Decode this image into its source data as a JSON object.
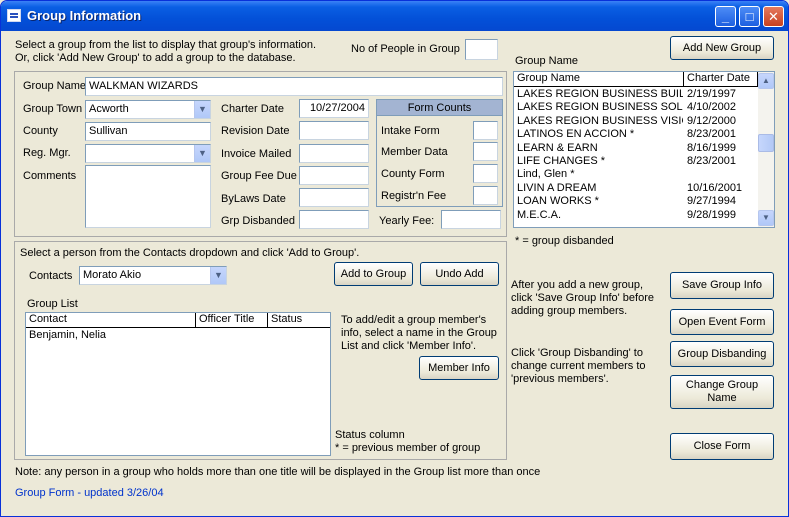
{
  "window": {
    "title": "Group Information",
    "controls": {
      "minimize": "_",
      "maximize": "□",
      "close": "✕"
    }
  },
  "intro": {
    "line1": "Select a group from the list to display that group's information.",
    "line2": "Or, click 'Add New Group'  to add a group to the database."
  },
  "no_people": {
    "label": "No of People in Group",
    "value": ""
  },
  "add_new_group_label": "Add New Group",
  "group_name": {
    "label": "Group Name",
    "value": "WALKMAN WIZARDS"
  },
  "group_town": {
    "label": "Group Town",
    "value": "Acworth"
  },
  "county": {
    "label": "County",
    "value": "Sullivan"
  },
  "reg_mgr": {
    "label": "Reg. Mgr.",
    "value": ""
  },
  "comments": {
    "label": "Comments",
    "value": ""
  },
  "charter_date": {
    "label": "Charter Date",
    "value": "10/27/2004"
  },
  "revision_date": {
    "label": "Revision Date",
    "value": ""
  },
  "invoice_mailed": {
    "label": "Invoice Mailed",
    "value": ""
  },
  "group_fee_due": {
    "label": "Group Fee Due",
    "value": ""
  },
  "bylaws_date": {
    "label": "ByLaws Date",
    "value": ""
  },
  "grp_disbanded": {
    "label": "Grp Disbanded",
    "value": ""
  },
  "form_counts": {
    "header": "Form Counts",
    "intake_form": "Intake Form",
    "member_data": "Member Data",
    "county_form": "County Form",
    "registrn_fee": "Registr'n Fee"
  },
  "yearly_fee": {
    "label": "Yearly Fee:",
    "value": ""
  },
  "group_list_panel": {
    "label": "Group Name",
    "col_name": "Group Name",
    "col_date": "Charter Date",
    "rows": [
      {
        "name": "LAKES REGION BUSINESS BUILDER",
        "date": "2/19/1997"
      },
      {
        "name": "LAKES REGION BUSINESS SOLUTIO",
        "date": "4/10/2002"
      },
      {
        "name": "LAKES REGION BUSINESS VISIONA",
        "date": "9/12/2000"
      },
      {
        "name": "LATINOS EN ACCION *",
        "date": "8/23/2001"
      },
      {
        "name": "LEARN & EARN",
        "date": "8/16/1999"
      },
      {
        "name": "LIFE CHANGES *",
        "date": "8/23/2001"
      },
      {
        "name": "Lind, Glen *",
        "date": ""
      },
      {
        "name": "LIVIN A DREAM",
        "date": "10/16/2001"
      },
      {
        "name": "LOAN WORKS *",
        "date": "9/27/1994"
      },
      {
        "name": "M.E.C.A.",
        "date": "9/28/1999"
      }
    ],
    "footnote": "* = group disbanded"
  },
  "contacts_section": {
    "instruction": "Select a person from the Contacts dropdown and click 'Add to Group'.",
    "contacts_label": "Contacts",
    "contacts_value": "Morato Akio",
    "add_to_group_label": "Add to Group",
    "undo_add_label": "Undo Add"
  },
  "members": {
    "label": "Group List",
    "col_contact": "Contact",
    "col_officer": "Officer Title",
    "col_status": "Status",
    "rows": [
      {
        "contact": "Benjamin, Nelia",
        "officer": "",
        "status": ""
      }
    ],
    "help_lines": [
      "To add/edit a group member's",
      "info, select a name in the Group",
      "List and click 'Member Info'."
    ],
    "member_info_label": "Member Info",
    "status_lines": [
      "Status column",
      "* = previous member of group"
    ]
  },
  "right_help": {
    "save_lines": [
      "After you add a new group,",
      "click 'Save Group Info' before",
      "adding group members."
    ],
    "disband_lines": [
      "Click 'Group Disbanding' to",
      "change current members to",
      "'previous members'."
    ]
  },
  "buttons": {
    "save_group_info": "Save Group Info",
    "open_event_form": "Open Event Form",
    "group_disbanding": "Group Disbanding",
    "change_group_name_1": "Change Group",
    "change_group_name_2": "Name",
    "close_form": "Close Form"
  },
  "footer": {
    "note": "Note: any person in a group who holds more than one title will be displayed in the Group list more than once",
    "updated": "Group Form - updated 3/26/04"
  },
  "colors": {
    "titlebar": "#0350d8",
    "window_bg": "#ece9d8",
    "form_counts_header": "#a3b4d2",
    "link_blue": "#0033cc"
  }
}
